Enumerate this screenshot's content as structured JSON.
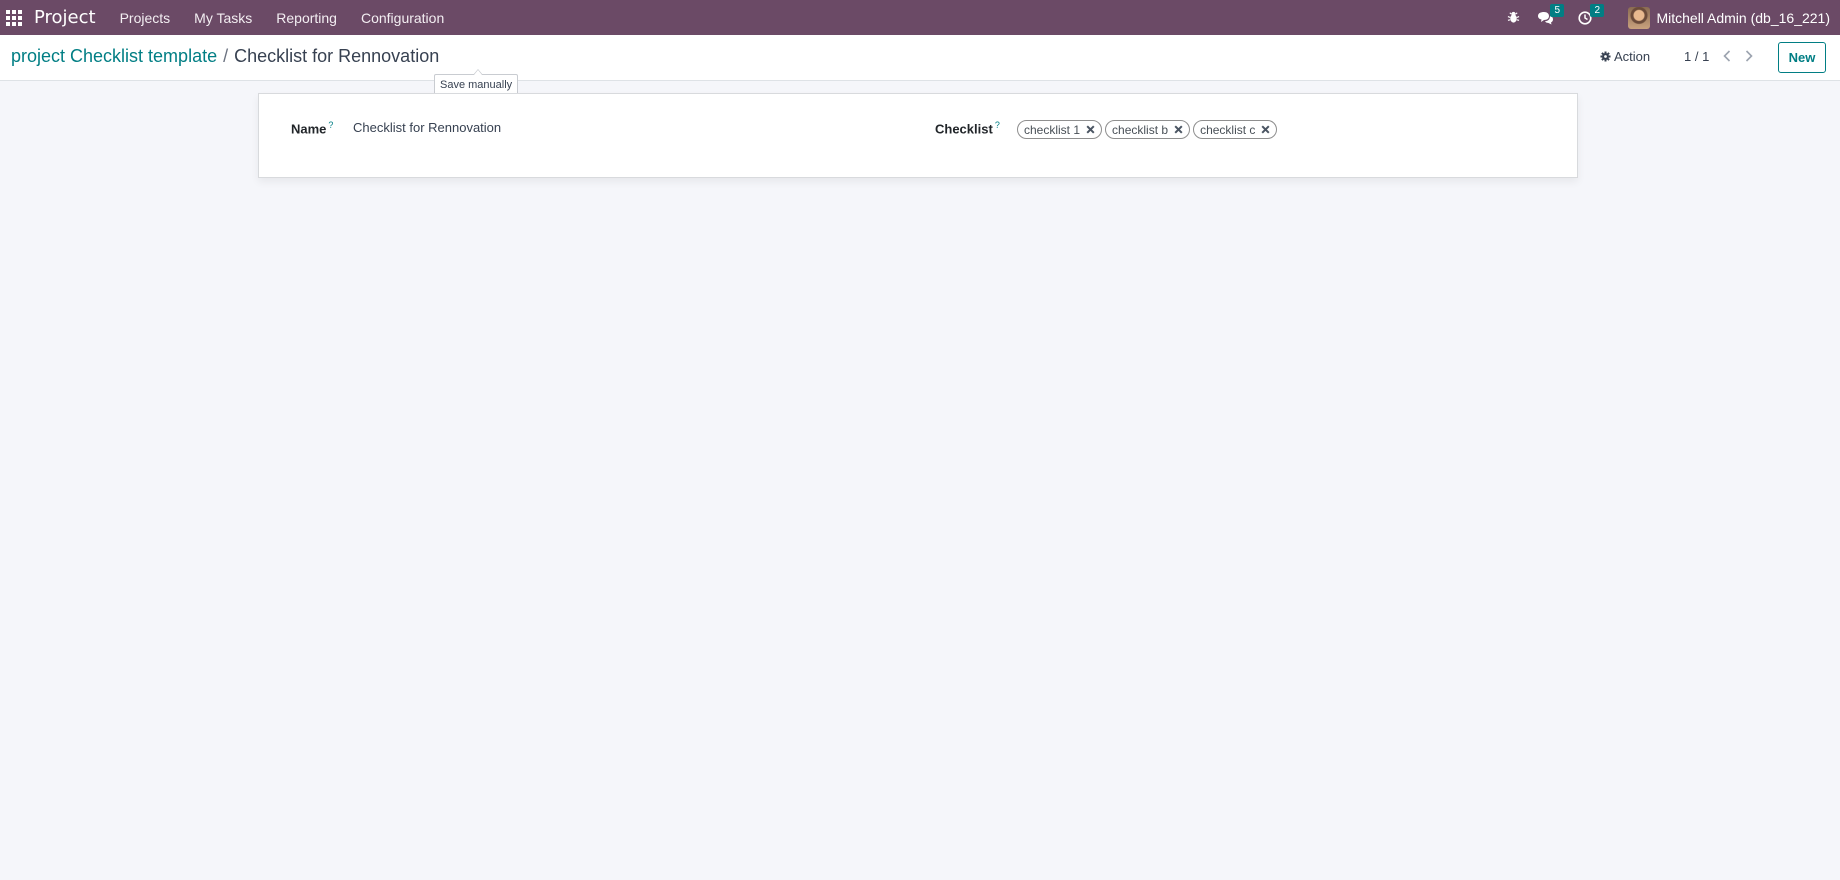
{
  "navbar": {
    "brand": "Project",
    "menu": [
      "Projects",
      "My Tasks",
      "Reporting",
      "Configuration"
    ],
    "messages_count": "5",
    "activities_count": "2",
    "user": "Mitchell Admin (db_16_221)",
    "bg_color": "#6b4a66"
  },
  "breadcrumb": {
    "parent": "project Checklist template",
    "separator": "/",
    "current": "Checklist for Rennovation"
  },
  "tooltip": "Save manually",
  "toolbar": {
    "action_label": "Action",
    "pager": "1 / 1",
    "new_label": "New"
  },
  "form": {
    "name_label": "Name",
    "name_value": "Checklist for Rennovation",
    "checklist_label": "Checklist",
    "help_mark": "?",
    "tags": [
      "checklist 1",
      "checklist b",
      "checklist c"
    ]
  },
  "colors": {
    "accent": "#017e84",
    "background": "#f5f6fa"
  }
}
